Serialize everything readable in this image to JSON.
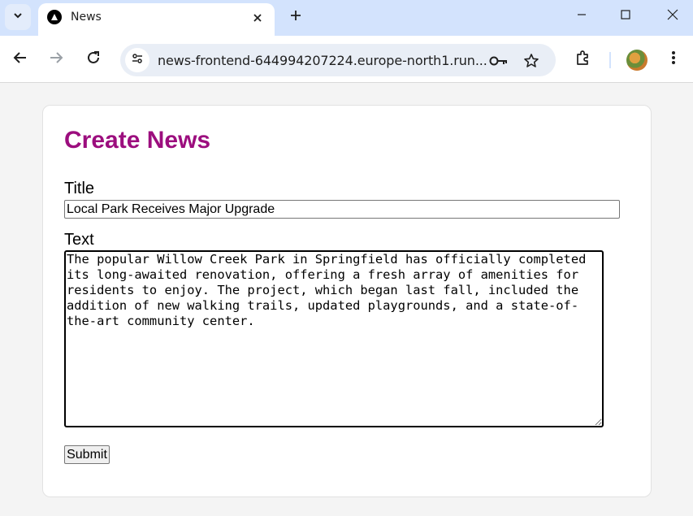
{
  "browser": {
    "tab": {
      "title": "News"
    },
    "url": "news-frontend-644994207224.europe-north1.run..."
  },
  "form": {
    "heading": "Create News",
    "title_label": "Title",
    "title_value": "Local Park Receives Major Upgrade",
    "text_label": "Text",
    "text_value": "The popular Willow Creek Park in Springfield has officially completed its long-awaited renovation, offering a fresh array of amenities for residents to enjoy. The project, which began last fall, included the addition of new walking trails, updated playgrounds, and a state-of-the-art community center.",
    "submit_label": "Submit"
  },
  "colors": {
    "heading": "#9c0e7e",
    "tabstrip": "#d3e3fd",
    "omnibox": "#e9eef6"
  }
}
